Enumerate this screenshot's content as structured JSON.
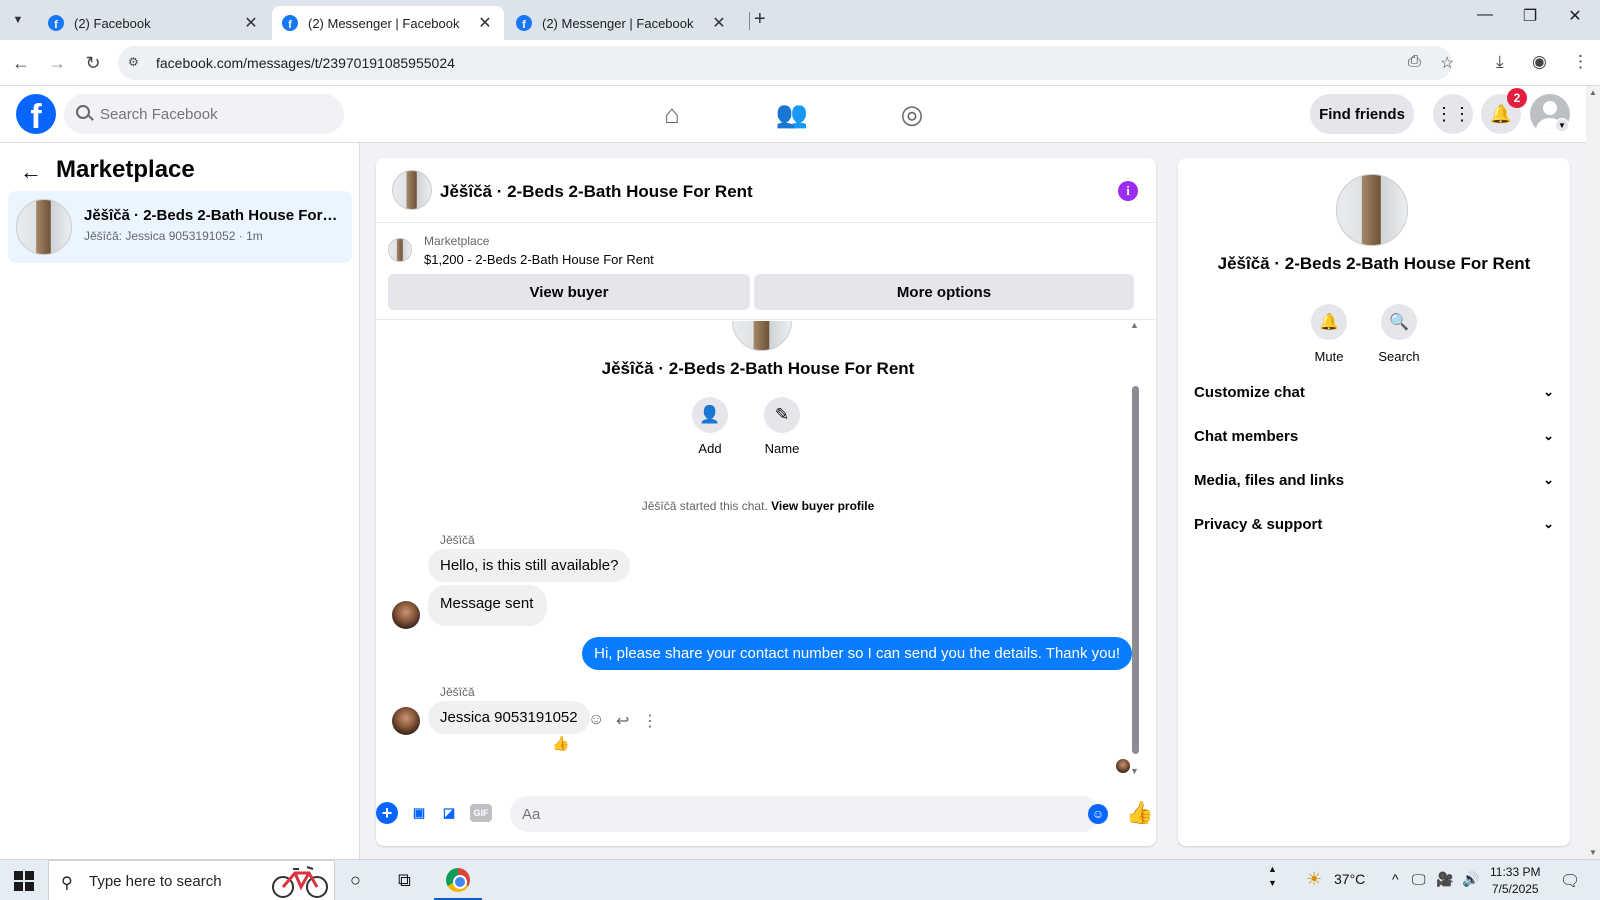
{
  "browser": {
    "tabs": [
      {
        "title": "(2) Facebook",
        "active": false
      },
      {
        "title": "(2) Messenger | Facebook",
        "active": true
      },
      {
        "title": "(2) Messenger | Facebook",
        "active": false
      }
    ],
    "new_tab_icon": "plus-icon",
    "url": "facebook.com/messages/t/23970191085955024"
  },
  "fb": {
    "logo_letter": "f",
    "search_placeholder": "Search Facebook",
    "find_friends": "Find friends",
    "notification_count": "2"
  },
  "left": {
    "title": "Marketplace",
    "conversation": {
      "title": "Jěšîčă · 2-Beds 2-Bath House For R...",
      "subtitle": "Jěšîčă: Jessica 9053191052 · 1m"
    }
  },
  "chat": {
    "header_name": "Jěšîčă · 2-Beds 2-Bath House For Rent",
    "info_glyph": "i",
    "marketplace_label": "Marketplace",
    "listing": "$1,200 - 2-Beds 2-Bath House For Rent",
    "view_buyer": "View buyer",
    "more_options": "More options",
    "thread_title": "Jěšîčă · 2-Beds 2-Bath House For Rent",
    "add_label": "Add",
    "name_label": "Name",
    "system_prefix": "Jěšîčă started this chat.",
    "system_link": "View buyer profile",
    "messages": [
      {
        "sender": "Jěšîčă",
        "text": "Hello, is this still available?",
        "direction": "in"
      },
      {
        "sender": "",
        "text": "Message sent",
        "direction": "in"
      },
      {
        "sender": "",
        "text": "Hi, please share your contact number so I can send you the details. Thank you!",
        "direction": "out"
      },
      {
        "sender": "Jěšîčă",
        "text": "Jessica 9053191052",
        "direction": "in"
      }
    ],
    "reaction": "👍",
    "composer_placeholder": "Aa",
    "composer_gif": "GIF"
  },
  "right": {
    "name": "Jěšîčă · 2-Beds 2-Bath House For Rent",
    "mute": "Mute",
    "search": "Search",
    "sections": [
      "Customize chat",
      "Chat members",
      "Media, files and links",
      "Privacy & support"
    ]
  },
  "taskbar": {
    "search_placeholder": "Type here to search",
    "temperature": "37°C",
    "time": "11:33 PM",
    "date": "7/5/2025"
  },
  "colors": {
    "facebook_blue": "#0866ff",
    "outgoing_bubble": "#0a7cff",
    "info_purple": "#9b2cf0",
    "badge_red": "#e41e3f"
  }
}
